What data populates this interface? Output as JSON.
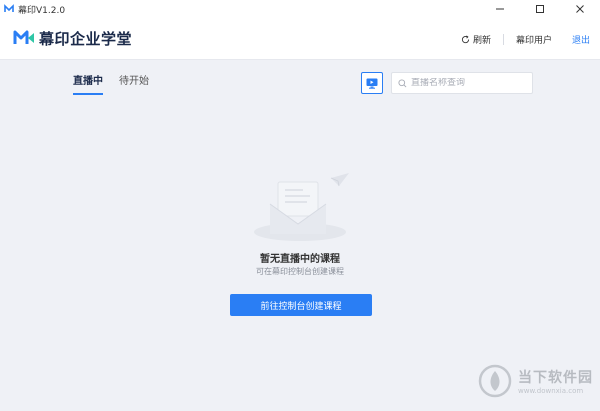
{
  "window": {
    "title": "幕印V1.2.0",
    "controls": [
      "minimize",
      "maximize",
      "close"
    ]
  },
  "header": {
    "logo_text": "幕印企业学堂",
    "refresh_label": "刷新",
    "user_label": "幕印用户",
    "logout_label": "退出"
  },
  "tabs": [
    {
      "label": "直播中",
      "active": true
    },
    {
      "label": "待开始",
      "active": false
    }
  ],
  "search": {
    "placeholder": "直播名称查询",
    "value": ""
  },
  "empty_state": {
    "title": "暂无直播中的课程",
    "subtitle": "可在幕印控制台创建课程",
    "button_label": "前往控制台创建课程"
  },
  "watermark": {
    "text": "当下软件园",
    "url": "www.downxia.com"
  },
  "colors": {
    "accent": "#2a7ef4",
    "background": "#eff1f6",
    "header_bg": "#ffffff"
  }
}
